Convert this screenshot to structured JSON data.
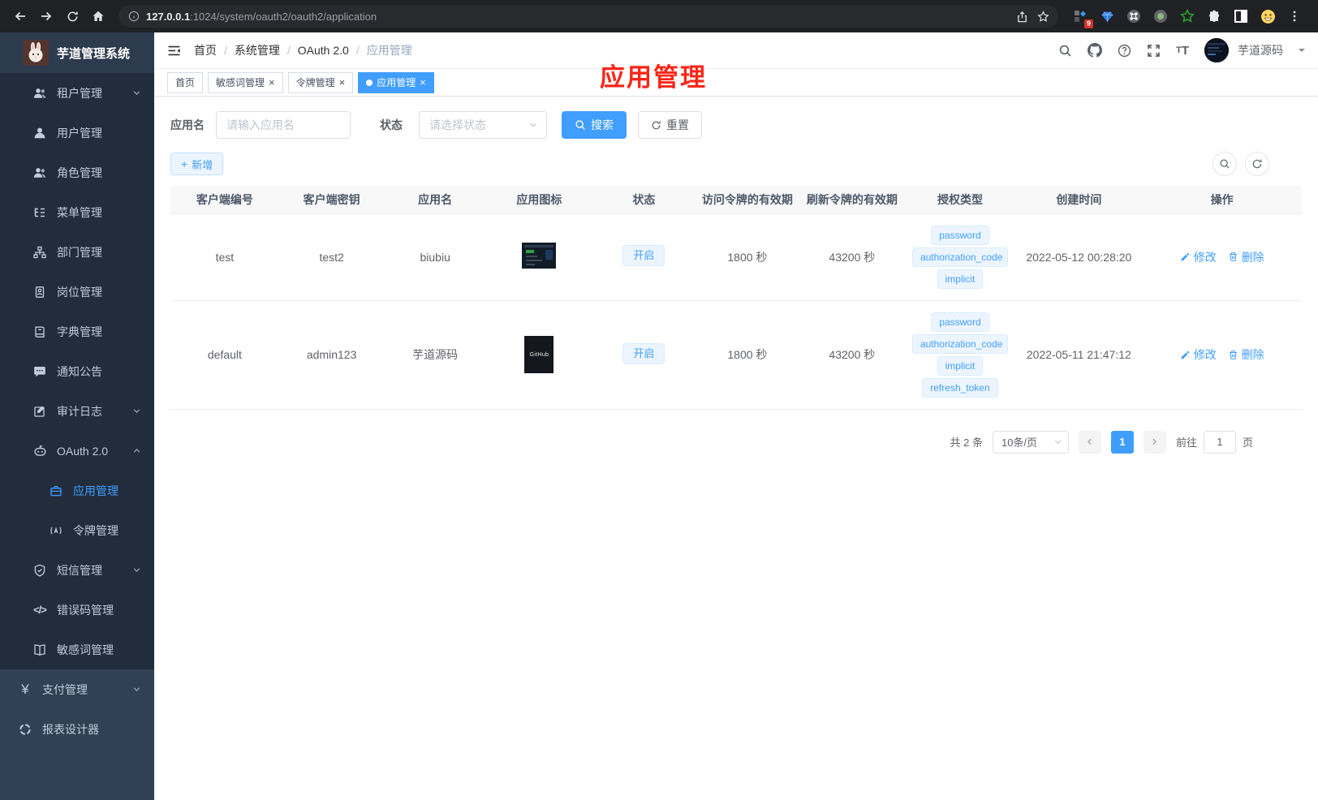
{
  "browser": {
    "url_host": "127.0.0.1",
    "url_rest": ":1024/system/oauth2/oauth2/application",
    "extension_badge": "9"
  },
  "sidebar": {
    "logo_title": "芋道管理系统",
    "items": [
      {
        "label": "租户管理",
        "icon": "users-icon"
      },
      {
        "label": "用户管理",
        "icon": "user-icon"
      },
      {
        "label": "角色管理",
        "icon": "role-icon"
      },
      {
        "label": "菜单管理",
        "icon": "menu-tree-icon"
      },
      {
        "label": "部门管理",
        "icon": "org-icon"
      },
      {
        "label": "岗位管理",
        "icon": "badge-icon"
      },
      {
        "label": "字典管理",
        "icon": "book-icon"
      },
      {
        "label": "通知公告",
        "icon": "message-icon"
      },
      {
        "label": "审计日志",
        "icon": "log-icon"
      },
      {
        "label": "OAuth 2.0",
        "icon": "robot-icon"
      },
      {
        "label": "应用管理",
        "icon": "briefcase-icon"
      },
      {
        "label": "令牌管理",
        "icon": "broadcast-icon"
      },
      {
        "label": "短信管理",
        "icon": "shield-icon"
      },
      {
        "label": "错误码管理",
        "icon": "code-icon"
      },
      {
        "label": "敏感词管理",
        "icon": "open-book-icon"
      },
      {
        "label": "支付管理",
        "icon": "yen-icon"
      },
      {
        "label": "报表设计器",
        "icon": "report-icon"
      }
    ],
    "glyphs": {
      "errcode": "</>",
      "pay": "¥"
    }
  },
  "navbar": {
    "breadcrumb": [
      "首页",
      "系统管理",
      "OAuth 2.0",
      "应用管理"
    ],
    "separator": "/",
    "username": "芋道源码",
    "font_small": "T",
    "font_large": "T"
  },
  "annotation": {
    "text": "应用管理"
  },
  "tabs": {
    "close_glyph": "×",
    "items": [
      {
        "label": "首页"
      },
      {
        "label": "敏感词管理"
      },
      {
        "label": "令牌管理"
      },
      {
        "label": "应用管理"
      }
    ]
  },
  "filters": {
    "name_label": "应用名",
    "name_placeholder": "请输入应用名",
    "status_label": "状态",
    "status_placeholder": "请选择状态",
    "search_label": "搜索",
    "reset_label": "重置"
  },
  "toolbar": {
    "add_label": "新增",
    "add_plus": "+"
  },
  "table": {
    "headers": [
      "客户端编号",
      "客户端密钥",
      "应用名",
      "应用图标",
      "状态",
      "访问令牌的有效期",
      "刷新令牌的有效期",
      "授权类型",
      "创建时间",
      "操作"
    ],
    "rows": [
      {
        "client_id": "test",
        "secret": "test2",
        "name": "biubiu",
        "status": "开启",
        "access_ttl": "1800 秒",
        "refresh_ttl": "43200 秒",
        "grant_types": [
          "password",
          "authorization_code",
          "implicit"
        ],
        "created": "2022-05-12 00:28:20",
        "edit": "修改",
        "delete": "删除"
      },
      {
        "client_id": "default",
        "secret": "admin123",
        "name": "芋道源码",
        "status": "开启",
        "access_ttl": "1800 秒",
        "refresh_ttl": "43200 秒",
        "grant_types": [
          "password",
          "authorization_code",
          "implicit",
          "refresh_token"
        ],
        "created": "2022-05-11 21:47:12",
        "edit": "修改",
        "delete": "删除",
        "icon_label": "GitHub"
      }
    ]
  },
  "pagination": {
    "total": "共 2 条",
    "page_size": "10条/页",
    "current": "1",
    "goto_label": "前往",
    "goto_value": "1",
    "unit": "页"
  },
  "colors": {
    "primary": "#409eff",
    "sidebar_bg": "#304156",
    "sidebar_submenu_bg": "#212d3d",
    "tag_bg": "#ecf5ff",
    "tag_border": "#d9ecff",
    "annotation_red": "#fc2619",
    "table_header_bg": "#f8f8f9"
  }
}
